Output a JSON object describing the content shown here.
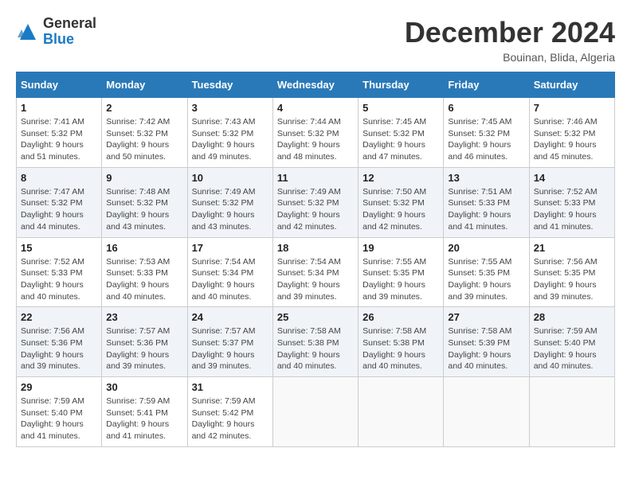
{
  "header": {
    "logo_general": "General",
    "logo_blue": "Blue",
    "month_title": "December 2024",
    "location": "Bouinan, Blida, Algeria"
  },
  "weekdays": [
    "Sunday",
    "Monday",
    "Tuesday",
    "Wednesday",
    "Thursday",
    "Friday",
    "Saturday"
  ],
  "weeks": [
    [
      {
        "day": "1",
        "sunrise": "7:41 AM",
        "sunset": "5:32 PM",
        "daylight": "9 hours and 51 minutes."
      },
      {
        "day": "2",
        "sunrise": "7:42 AM",
        "sunset": "5:32 PM",
        "daylight": "9 hours and 50 minutes."
      },
      {
        "day": "3",
        "sunrise": "7:43 AM",
        "sunset": "5:32 PM",
        "daylight": "9 hours and 49 minutes."
      },
      {
        "day": "4",
        "sunrise": "7:44 AM",
        "sunset": "5:32 PM",
        "daylight": "9 hours and 48 minutes."
      },
      {
        "day": "5",
        "sunrise": "7:45 AM",
        "sunset": "5:32 PM",
        "daylight": "9 hours and 47 minutes."
      },
      {
        "day": "6",
        "sunrise": "7:45 AM",
        "sunset": "5:32 PM",
        "daylight": "9 hours and 46 minutes."
      },
      {
        "day": "7",
        "sunrise": "7:46 AM",
        "sunset": "5:32 PM",
        "daylight": "9 hours and 45 minutes."
      }
    ],
    [
      {
        "day": "8",
        "sunrise": "7:47 AM",
        "sunset": "5:32 PM",
        "daylight": "9 hours and 44 minutes."
      },
      {
        "day": "9",
        "sunrise": "7:48 AM",
        "sunset": "5:32 PM",
        "daylight": "9 hours and 43 minutes."
      },
      {
        "day": "10",
        "sunrise": "7:49 AM",
        "sunset": "5:32 PM",
        "daylight": "9 hours and 43 minutes."
      },
      {
        "day": "11",
        "sunrise": "7:49 AM",
        "sunset": "5:32 PM",
        "daylight": "9 hours and 42 minutes."
      },
      {
        "day": "12",
        "sunrise": "7:50 AM",
        "sunset": "5:32 PM",
        "daylight": "9 hours and 42 minutes."
      },
      {
        "day": "13",
        "sunrise": "7:51 AM",
        "sunset": "5:33 PM",
        "daylight": "9 hours and 41 minutes."
      },
      {
        "day": "14",
        "sunrise": "7:52 AM",
        "sunset": "5:33 PM",
        "daylight": "9 hours and 41 minutes."
      }
    ],
    [
      {
        "day": "15",
        "sunrise": "7:52 AM",
        "sunset": "5:33 PM",
        "daylight": "9 hours and 40 minutes."
      },
      {
        "day": "16",
        "sunrise": "7:53 AM",
        "sunset": "5:33 PM",
        "daylight": "9 hours and 40 minutes."
      },
      {
        "day": "17",
        "sunrise": "7:54 AM",
        "sunset": "5:34 PM",
        "daylight": "9 hours and 40 minutes."
      },
      {
        "day": "18",
        "sunrise": "7:54 AM",
        "sunset": "5:34 PM",
        "daylight": "9 hours and 39 minutes."
      },
      {
        "day": "19",
        "sunrise": "7:55 AM",
        "sunset": "5:35 PM",
        "daylight": "9 hours and 39 minutes."
      },
      {
        "day": "20",
        "sunrise": "7:55 AM",
        "sunset": "5:35 PM",
        "daylight": "9 hours and 39 minutes."
      },
      {
        "day": "21",
        "sunrise": "7:56 AM",
        "sunset": "5:35 PM",
        "daylight": "9 hours and 39 minutes."
      }
    ],
    [
      {
        "day": "22",
        "sunrise": "7:56 AM",
        "sunset": "5:36 PM",
        "daylight": "9 hours and 39 minutes."
      },
      {
        "day": "23",
        "sunrise": "7:57 AM",
        "sunset": "5:36 PM",
        "daylight": "9 hours and 39 minutes."
      },
      {
        "day": "24",
        "sunrise": "7:57 AM",
        "sunset": "5:37 PM",
        "daylight": "9 hours and 39 minutes."
      },
      {
        "day": "25",
        "sunrise": "7:58 AM",
        "sunset": "5:38 PM",
        "daylight": "9 hours and 40 minutes."
      },
      {
        "day": "26",
        "sunrise": "7:58 AM",
        "sunset": "5:38 PM",
        "daylight": "9 hours and 40 minutes."
      },
      {
        "day": "27",
        "sunrise": "7:58 AM",
        "sunset": "5:39 PM",
        "daylight": "9 hours and 40 minutes."
      },
      {
        "day": "28",
        "sunrise": "7:59 AM",
        "sunset": "5:40 PM",
        "daylight": "9 hours and 40 minutes."
      }
    ],
    [
      {
        "day": "29",
        "sunrise": "7:59 AM",
        "sunset": "5:40 PM",
        "daylight": "9 hours and 41 minutes."
      },
      {
        "day": "30",
        "sunrise": "7:59 AM",
        "sunset": "5:41 PM",
        "daylight": "9 hours and 41 minutes."
      },
      {
        "day": "31",
        "sunrise": "7:59 AM",
        "sunset": "5:42 PM",
        "daylight": "9 hours and 42 minutes."
      },
      null,
      null,
      null,
      null
    ]
  ],
  "labels": {
    "sunrise": "Sunrise:",
    "sunset": "Sunset:",
    "daylight": "Daylight:"
  }
}
